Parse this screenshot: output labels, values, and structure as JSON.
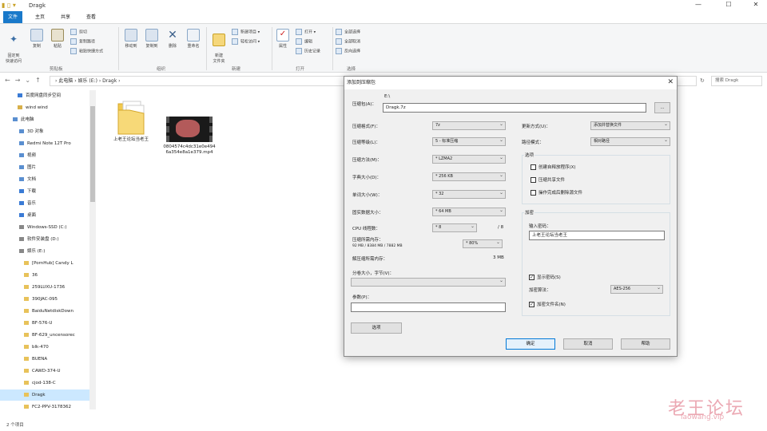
{
  "window": {
    "title": "Dragk",
    "minimize": "—",
    "maximize": "☐",
    "close": "✕"
  },
  "tabs": [
    "文件",
    "主页",
    "共享",
    "查看"
  ],
  "ribbon": {
    "clipboard": {
      "pin": "固定到\n快速访问",
      "copy": "复制",
      "paste": "粘贴",
      "cut": "剪切",
      "copy_path": "复制路径",
      "paste_shortcut": "粘贴快捷方式",
      "label": "剪贴板"
    },
    "organize": {
      "move_to": "移动到",
      "copy_to": "复制到",
      "delete": "删除",
      "rename": "重命名",
      "label": "组织"
    },
    "new": {
      "new_folder": "新建\n文件夹",
      "new_item": "新建项目 ▾",
      "easy_access": "轻松访问 ▾",
      "label": "新建"
    },
    "open": {
      "properties": "属性",
      "open": "打开 ▾",
      "edit": "编辑",
      "history": "历史记录",
      "label": "打开"
    },
    "select": {
      "select_all": "全部选择",
      "select_none": "全部取消",
      "invert": "反向选择",
      "label": "选择"
    }
  },
  "address": {
    "path": "›  此电脑  ›  娱乐 (E:)  ›  Dragk  ›",
    "search_placeholder": "搜索 Dragk"
  },
  "sidebar": [
    "百度网盘同步空间",
    "wind wind",
    "此电脑",
    "3D 对象",
    "Redmi Note 12T Pro",
    "视频",
    "图片",
    "文档",
    "下载",
    "音乐",
    "桌面",
    "Windows-SSD (C:)",
    "软件安装盘 (D:)",
    "娱乐 (E:)",
    "[PornHub] Candy L",
    "36",
    "259LUXU-1736",
    "390JAC-095",
    "BaiduNetdiskDown",
    "BF-576-U",
    "BF-629_uncensorec",
    "blk-470",
    "BUENA",
    "CAWD-374-U",
    "cjod-138-C",
    "Dragk",
    "FC2-PPV-3178362"
  ],
  "files": [
    {
      "name": "上老王论坛当老王",
      "type": "folder"
    },
    {
      "name": "0804574c4dc31e0e4946a354e8a1e379.mp4",
      "type": "video"
    }
  ],
  "status": {
    "count": "2 个项目"
  },
  "dialog": {
    "title": "添加到压缩包",
    "close": "✕",
    "archive_name_label": "压缩包(A)：",
    "archive_path": "E:\\",
    "archive_name_value": "Dragk.7z",
    "browse": "...",
    "format_label": "压缩格式(F)：",
    "format_value": "7z",
    "level_label": "压缩等级(L)：",
    "level_value": "5 - 标准压缩",
    "method_label": "压缩方法(M)：",
    "method_value": "* LZMA2",
    "dict_label": "字典大小(D)：",
    "dict_value": "* 256 KB",
    "word_label": "单词大小(W)：",
    "word_value": "* 32",
    "solid_label": "固实数据大小：",
    "solid_value": "* 64 MB",
    "cpu_label": "CPU 线程数：",
    "cpu_value": "* 8",
    "cpu_total": "/ 8",
    "mem_label": "压缩所需内存：",
    "mem_detail": "92 MB / 8384 MB / 7882 MB",
    "mem_value": "* 80%",
    "decomp_label": "解压缩所需内存：",
    "decomp_value": "3 MB",
    "split_label": "分卷大小，字节(V)：",
    "params_label": "参数(P)：",
    "options_button": "选项",
    "update_label": "更新方式(U)：",
    "update_value": "添加并替换文件",
    "path_mode_label": "路径模式：",
    "path_mode_value": "相对路径",
    "options_group": "选项",
    "opt_sfx": "创建自释放程序(X)",
    "opt_shared": "压缩共享文件",
    "opt_delete": "操作完成后删除源文件",
    "encrypt_group": "加密",
    "password_label": "输入密码：",
    "password_value": "上老王论坛当老王",
    "show_password": "显示密码(S)",
    "method_enc_label": "加密算法：",
    "method_enc_value": "AES-256",
    "encrypt_names": "加密文件名(N)",
    "ok": "确定",
    "cancel": "取消",
    "help": "帮助"
  },
  "watermark": {
    "line1": "老王论坛",
    "line2": "laowang.vip"
  }
}
